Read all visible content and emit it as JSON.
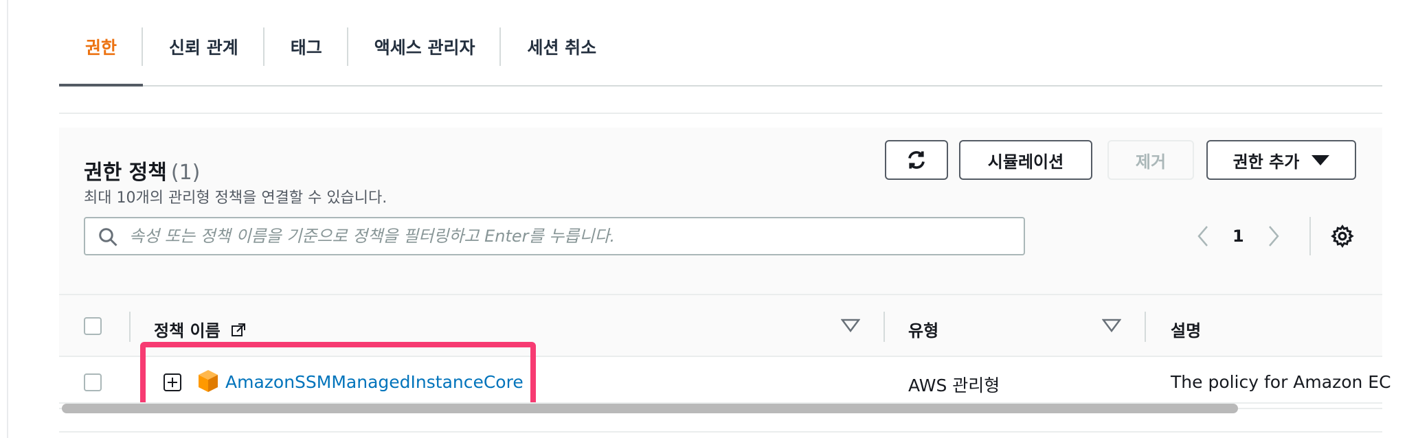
{
  "tabs": [
    {
      "label": "권한",
      "active": true
    },
    {
      "label": "신뢰 관계",
      "active": false
    },
    {
      "label": "태그",
      "active": false
    },
    {
      "label": "액세스 관리자",
      "active": false
    },
    {
      "label": "세션 취소",
      "active": false
    }
  ],
  "policies": {
    "title": "권한 정책",
    "count": "(1)",
    "description": "최대 10개의 관리형 정책을 연결할 수 있습니다.",
    "buttons": {
      "refresh_icon": "refresh-icon",
      "simulate": "시뮬레이션",
      "remove": "제거",
      "add": "권한 추가"
    },
    "search": {
      "placeholder": "속성 또는 정책 이름을 기준으로 정책을 필터링하고 Enter를 누릅니다.",
      "value": ""
    },
    "pagination": {
      "current_page": "1"
    },
    "columns": [
      "정책 이름",
      "유형",
      "설명"
    ],
    "rows": [
      {
        "name": "AmazonSSMManagedInstanceCore",
        "type": "AWS 관리형",
        "description": "The policy for Amazon EC"
      }
    ]
  },
  "colors": {
    "active_tab": "#ec7211",
    "link": "#0073bb",
    "highlight": "#f73b72",
    "aws_icon": "#f90"
  }
}
